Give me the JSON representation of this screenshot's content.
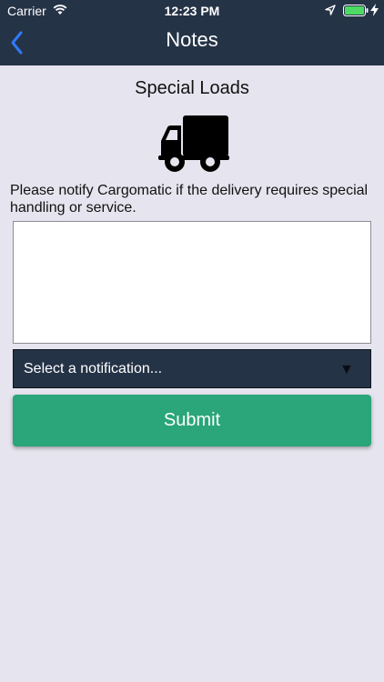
{
  "status_bar": {
    "carrier": "Carrier",
    "time": "12:23 PM",
    "icons": [
      "wifi-icon",
      "location-arrow-icon",
      "battery-icon",
      "charging-bolt-icon"
    ],
    "battery_color": "#4cd964"
  },
  "nav": {
    "title": "Notes",
    "back_icon": "chevron-left-icon",
    "back_color": "#2f7bf6",
    "background": "#253347"
  },
  "main": {
    "heading": "Special Loads",
    "icon": "truck-icon",
    "description": "Please notify Cargomatic if the delivery requires special handling or service.",
    "notes_value": "",
    "select": {
      "value": "Select a notification...",
      "arrow": "▼"
    },
    "submit_label": "Submit",
    "submit_color": "#2aa67a"
  }
}
